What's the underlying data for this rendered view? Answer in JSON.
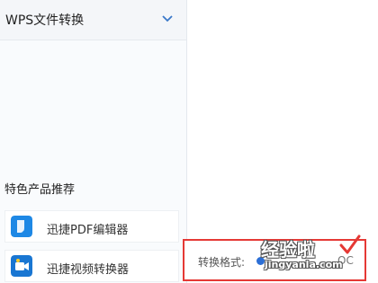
{
  "sidebar": {
    "title": "WPS文件转换",
    "section_title": "特色产品推荐",
    "products": [
      {
        "label": "迅捷PDF编辑器",
        "icon": "pdf-editor-icon",
        "color": "#1e88e5"
      },
      {
        "label": "迅捷视频转换器",
        "icon": "video-converter-icon",
        "color": "#1976d2"
      }
    ]
  },
  "format": {
    "label": "转换格式:",
    "option": "OC"
  },
  "watermark": {
    "text": "经验啦",
    "url": "jingyanla.com"
  },
  "colors": {
    "highlight_border": "#e53935",
    "accent": "#2c6fd6"
  }
}
